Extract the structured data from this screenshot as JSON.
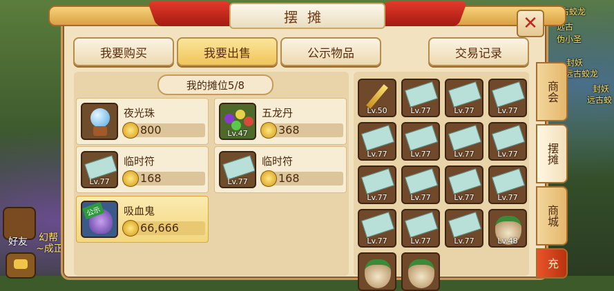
{
  "window": {
    "title": "摆摊",
    "close_label": "✕"
  },
  "tabs": [
    {
      "label": "我要购买",
      "active": false
    },
    {
      "label": "我要出售",
      "active": true
    },
    {
      "label": "公示物品",
      "active": false
    },
    {
      "label": "交易记录",
      "active": false
    }
  ],
  "stall": {
    "header": "我的摊位5/8",
    "slots": [
      {
        "name": "夜光珠",
        "price": "800",
        "level": "",
        "icon": "night-pearl-icon",
        "public": false
      },
      {
        "name": "五龙丹",
        "price": "368",
        "level": "Lv.47",
        "icon": "five-dragon-pill-icon",
        "public": false
      },
      {
        "name": "临时符",
        "price": "168",
        "level": "Lv.77",
        "icon": "temporary-talisman-icon",
        "public": false
      },
      {
        "name": "临时符",
        "price": "168",
        "level": "Lv.77",
        "icon": "temporary-talisman-icon",
        "public": false
      },
      {
        "name": "吸血鬼",
        "price": "66,666",
        "level": "",
        "icon": "vampire-pet-icon",
        "public": true,
        "badge": "公示"
      }
    ]
  },
  "inventory": {
    "cells": [
      {
        "level": "Lv.50",
        "icon": "weapon-icon"
      },
      {
        "level": "Lv.77",
        "icon": "talisman-icon"
      },
      {
        "level": "Lv.77",
        "icon": "talisman-icon"
      },
      {
        "level": "Lv.77",
        "icon": "talisman-icon"
      },
      {
        "level": "Lv.77",
        "icon": "talisman-icon"
      },
      {
        "level": "Lv.77",
        "icon": "talisman-icon"
      },
      {
        "level": "Lv.77",
        "icon": "talisman-icon"
      },
      {
        "level": "Lv.77",
        "icon": "talisman-icon"
      },
      {
        "level": "Lv.77",
        "icon": "talisman-icon"
      },
      {
        "level": "Lv.77",
        "icon": "talisman-icon"
      },
      {
        "level": "Lv.77",
        "icon": "talisman-icon"
      },
      {
        "level": "Lv.77",
        "icon": "talisman-icon"
      },
      {
        "level": "Lv.77",
        "icon": "talisman-icon"
      },
      {
        "level": "Lv.77",
        "icon": "talisman-icon"
      },
      {
        "level": "Lv.77",
        "icon": "talisman-icon"
      },
      {
        "level": "Lv.48",
        "icon": "herb-pot-icon"
      },
      {
        "level": "",
        "icon": "herb-pot-icon"
      },
      {
        "level": "",
        "icon": "herb-pot-icon"
      }
    ]
  },
  "side_tabs": [
    {
      "label": "商会",
      "active": false
    },
    {
      "label": "摆摊",
      "active": true
    },
    {
      "label": "商城",
      "active": false
    },
    {
      "label": "充",
      "active": false
    }
  ],
  "background": {
    "hud": {
      "friends": "好友",
      "chat_partial": "幻帮",
      "status_partial": "~成正"
    },
    "world_text": [
      "远古蛟龙",
      "远古",
      "伪小圣",
      "封妖",
      "远古蛟龙",
      "封妖",
      "远古蛟"
    ]
  },
  "colors": {
    "accent": "#f0c55a",
    "title_text": "#6a3b12",
    "close_x": "#c0261a"
  }
}
